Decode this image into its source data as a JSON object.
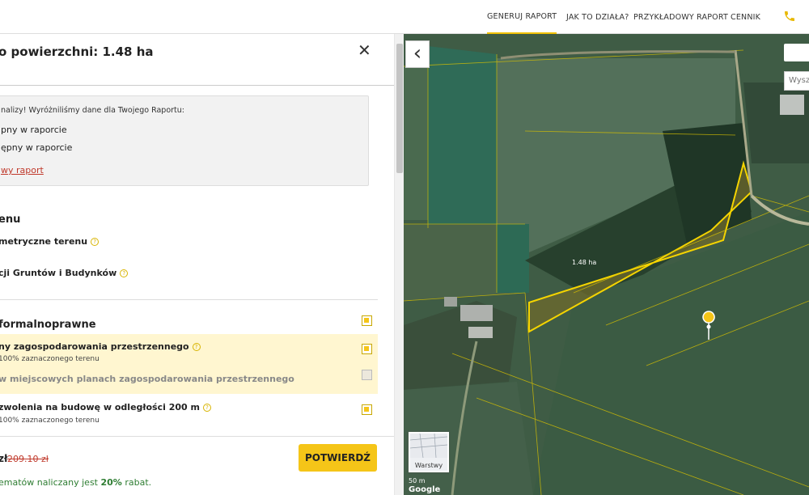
{
  "nav": {
    "items": [
      "GENERUJ RAPORT",
      "JAK TO DZIAŁA?",
      "PRZYKŁADOWY RAPORT",
      "CENNIK"
    ],
    "active": "GENERUJ RAPORT"
  },
  "panel": {
    "title": "o powierzchni: 1.48 ha",
    "info": {
      "intro": "nalizy! Wyróżniliśmy dane dla Twojego Raportu:",
      "line1": "pny w raporcie",
      "line2": "ępny w raporcie",
      "link": "wy raport"
    },
    "section1": {
      "title": "enu",
      "items": [
        {
          "label": "metryczne terenu",
          "sub": ""
        },
        {
          "label": "cji Gruntów i Budynków",
          "sub": ""
        }
      ]
    },
    "section2": {
      "title": "formalnoprawne",
      "items": [
        {
          "label": "ny zagospodarowania przestrzennego",
          "sub": "100% zaznaczonego terenu",
          "checked": true
        },
        {
          "label": "w miejscowych planach zagospodarowania przestrzennego",
          "checked": false
        },
        {
          "label": "zwolenia na budowę w odległości 200 m",
          "sub": "100% zaznaczonego terenu",
          "checked": true
        }
      ]
    },
    "footer": {
      "price_label": "zł",
      "old_price": "209.10 zł",
      "confirm": "POTWIERDŹ",
      "promo_prefix": "ematów naliczany jest ",
      "promo_value": "20%",
      "promo_suffix": " rabat."
    }
  },
  "map": {
    "area_label": "1.48 ha",
    "search_placeholder": "Wyszu",
    "layers_label": "Warstwy",
    "scale": "50 m",
    "logo": "Google"
  },
  "colors": {
    "accent": "#f5c518",
    "link": "#c0392b",
    "promo": "#2e7d32",
    "highlight": "#fff6d0"
  }
}
